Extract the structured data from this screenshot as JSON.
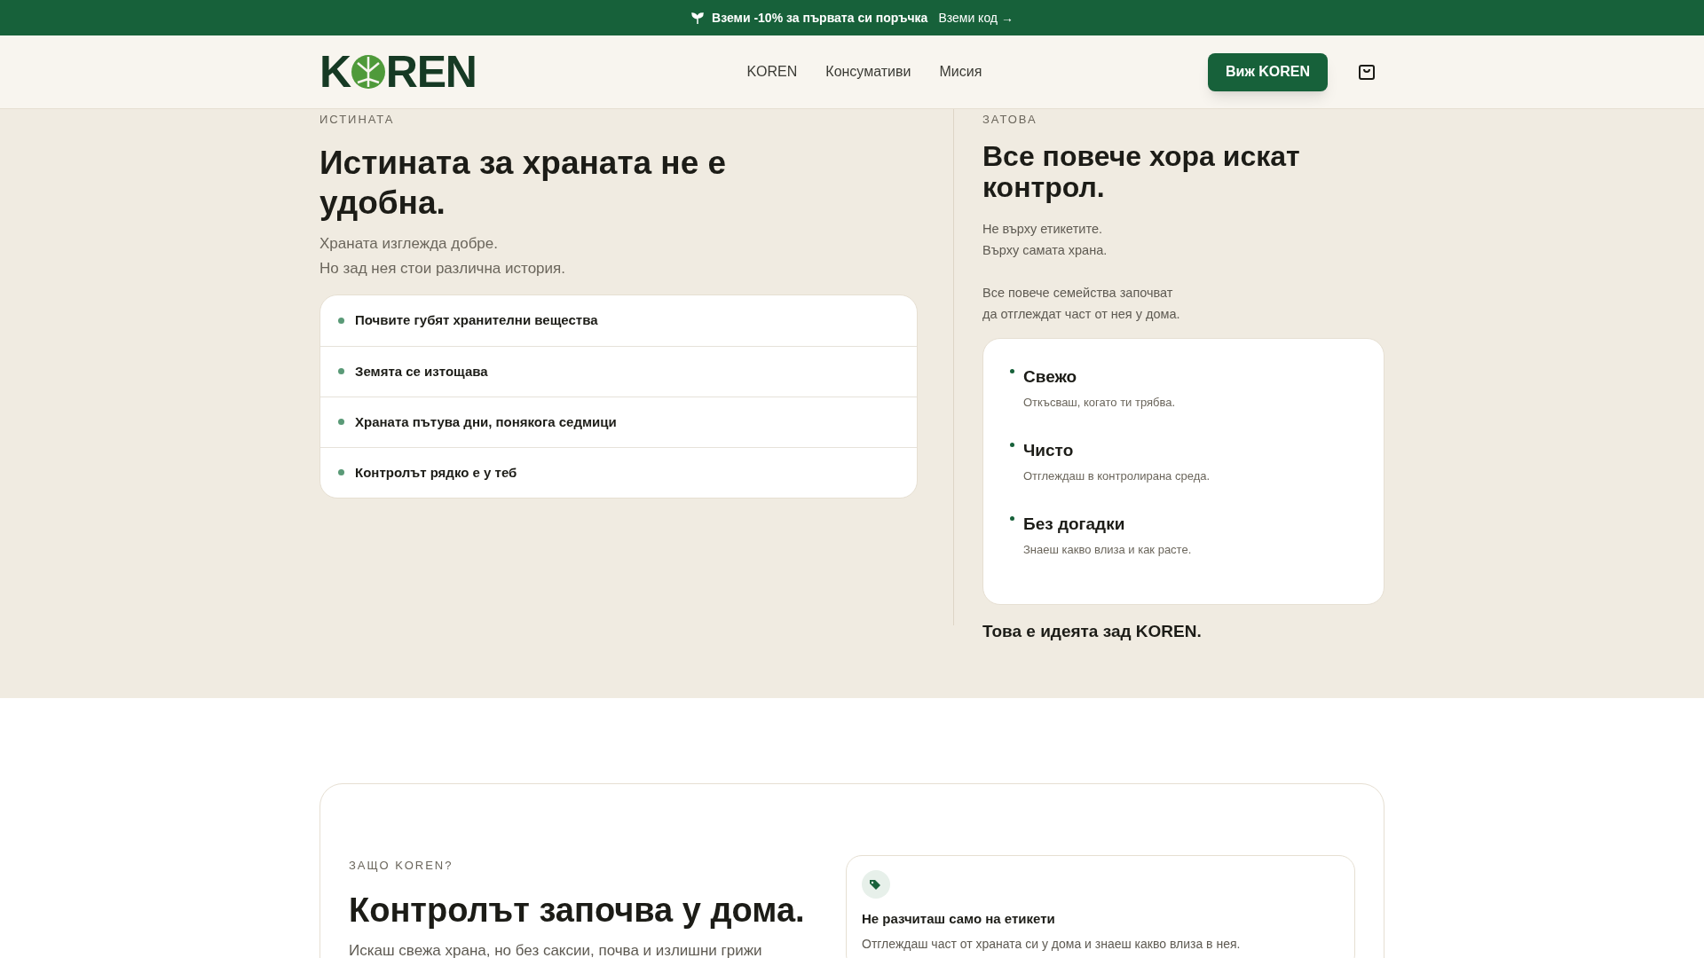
{
  "promo_bar": {
    "text": "Вземи -10% за първата си поръчка",
    "link": "Вземи код →"
  },
  "header": {
    "logo": {
      "before": "K",
      "after": "REN"
    },
    "nav": [
      {
        "label": "KOREN"
      },
      {
        "label": "Консумативи"
      },
      {
        "label": "Мисия"
      }
    ],
    "cta": "Виж KOREN"
  },
  "truth": {
    "eyebrow": "ИСТИНАТА",
    "heading": "Истината за храната не е удобна.",
    "lines": [
      "Храната изглежда добре.",
      "Но зад нея стои различна история."
    ],
    "items": [
      "Почвите губят хранителни вещества",
      "Земята се изтощава",
      "Храната пътува дни, понякога седмици",
      "Контролът рядко е у теб"
    ]
  },
  "therefore": {
    "eyebrow": "ЗАТОВА",
    "heading": "Все повече хора искат контрол.",
    "paragraphs": [
      [
        "Не върху етикетите.",
        "Върху самата храна."
      ],
      [
        "Все повече семейства започват",
        "да отглеждат част от нея у дома."
      ]
    ],
    "points": [
      {
        "title": "Свежо",
        "text": "Откъсваш, когато ти трябва."
      },
      {
        "title": "Чисто",
        "text": "Отглеждаш в контролирана среда."
      },
      {
        "title": "Без догадки",
        "text": "Знаеш какво влиза и как расте."
      }
    ],
    "closing": "Това е идеята зад KOREN."
  },
  "why": {
    "eyebrow": "ЗАЩО KOREN?",
    "heading": "Контролът започва у дома.",
    "text": "Искаш свежа храна, но без саксии, почва и излишни грижи",
    "feature": {
      "title": "Не разчиташ само на етикети",
      "text": "Отглеждаш част от храната си у дома и знаеш какво влиза в нея."
    }
  }
}
